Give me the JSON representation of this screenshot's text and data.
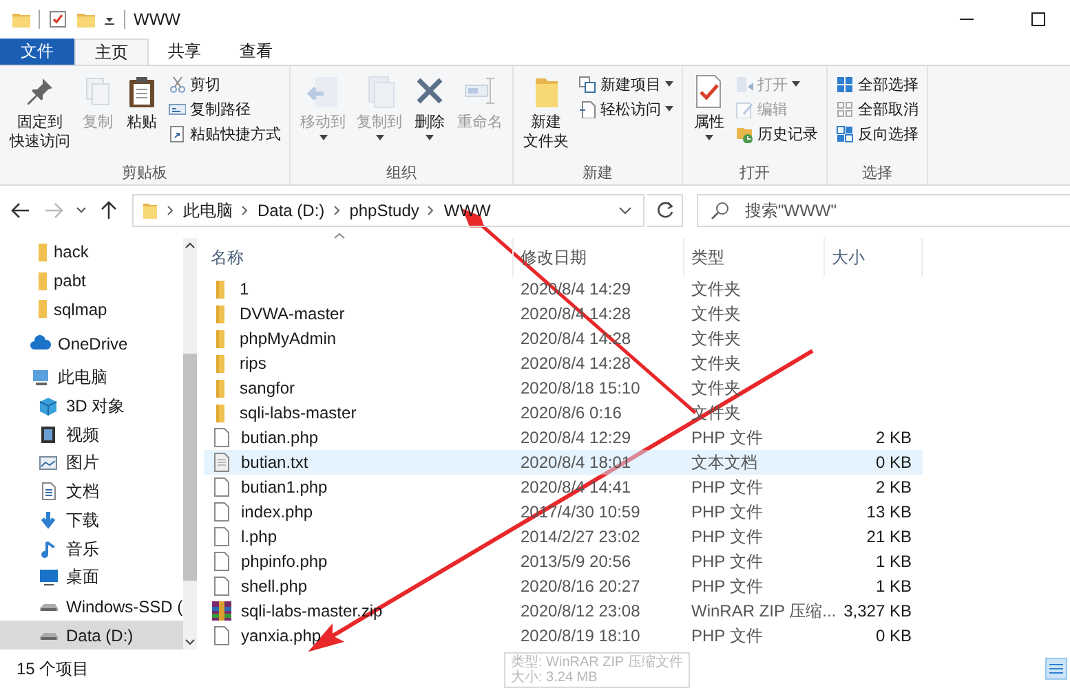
{
  "title_bar": {
    "title": "WWW"
  },
  "ribbon_tabs": [
    {
      "label": "文件",
      "kind": "file",
      "selected": false
    },
    {
      "label": "主页",
      "kind": "tab",
      "selected": true
    },
    {
      "label": "共享",
      "kind": "tab",
      "selected": false
    },
    {
      "label": "查看",
      "kind": "tab",
      "selected": false
    }
  ],
  "ribbon_groups": [
    {
      "label": "剪贴板",
      "commands": [
        {
          "label": [
            "固定到",
            "快速访问"
          ],
          "kind": "large",
          "disabled": false,
          "dropdown": false
        },
        {
          "label": "复制",
          "kind": "large",
          "disabled": true,
          "dropdown": false
        },
        {
          "label": "粘贴",
          "kind": "large",
          "disabled": false,
          "dropdown": false
        },
        {
          "label": "剪切",
          "kind": "small",
          "disabled": false,
          "dropdown": false
        },
        {
          "label": "复制路径",
          "kind": "small",
          "disabled": false,
          "dropdown": false
        },
        {
          "label": "粘贴快捷方式",
          "kind": "small",
          "disabled": false,
          "dropdown": false
        }
      ]
    },
    {
      "label": "组织",
      "commands": [
        {
          "label": "移动到",
          "kind": "large",
          "disabled": true,
          "dropdown": true
        },
        {
          "label": "复制到",
          "kind": "large",
          "disabled": true,
          "dropdown": true
        },
        {
          "label": "删除",
          "kind": "large",
          "disabled": false,
          "dropdown": true
        },
        {
          "label": "重命名",
          "kind": "large",
          "disabled": true,
          "dropdown": false
        }
      ]
    },
    {
      "label": "新建",
      "commands": [
        {
          "label": [
            "新建",
            "文件夹"
          ],
          "kind": "large",
          "disabled": false,
          "dropdown": false
        },
        {
          "label": "新建项目",
          "kind": "small",
          "disabled": false,
          "dropdown": true
        },
        {
          "label": "轻松访问",
          "kind": "small",
          "disabled": false,
          "dropdown": true
        }
      ]
    },
    {
      "label": "打开",
      "commands": [
        {
          "label": "属性",
          "kind": "large",
          "disabled": false,
          "dropdown": true
        },
        {
          "label": "打开",
          "kind": "small",
          "disabled": true,
          "dropdown": true
        },
        {
          "label": "编辑",
          "kind": "small",
          "disabled": true,
          "dropdown": false
        },
        {
          "label": "历史记录",
          "kind": "small",
          "disabled": false,
          "dropdown": false
        }
      ]
    },
    {
      "label": "选择",
      "commands": [
        {
          "label": "全部选择",
          "kind": "small",
          "disabled": false,
          "dropdown": false
        },
        {
          "label": "全部取消",
          "kind": "small",
          "disabled": false,
          "dropdown": false
        },
        {
          "label": "反向选择",
          "kind": "small",
          "disabled": false,
          "dropdown": false
        }
      ]
    }
  ],
  "address_bar": {
    "back_disabled": false,
    "forward_disabled": true,
    "breadcrumb": [
      "此电脑",
      "Data (D:)",
      "phpStudy",
      "WWW"
    ]
  },
  "search": {
    "placeholder": "搜索\"WWW\""
  },
  "sidebar": {
    "items": [
      {
        "label": "hack",
        "kind": "folder",
        "selected": false
      },
      {
        "label": "pabt",
        "kind": "folder",
        "selected": false
      },
      {
        "label": "sqlmap",
        "kind": "folder",
        "selected": false
      },
      {
        "label": "OneDrive",
        "kind": "cloud",
        "selected": false
      },
      {
        "label": "此电脑",
        "kind": "pc",
        "selected": false,
        "children": [
          {
            "label": "3D 对象",
            "kind": "cube",
            "selected": false
          },
          {
            "label": "视频",
            "kind": "video",
            "selected": false
          },
          {
            "label": "图片",
            "kind": "picture",
            "selected": false
          },
          {
            "label": "文档",
            "kind": "document",
            "selected": false
          },
          {
            "label": "下载",
            "kind": "download",
            "selected": false
          },
          {
            "label": "音乐",
            "kind": "music",
            "selected": false
          },
          {
            "label": "桌面",
            "kind": "desktop",
            "selected": false
          },
          {
            "label": "Windows-SSD (",
            "kind": "drive",
            "selected": false
          },
          {
            "label": "Data (D:)",
            "kind": "drive",
            "selected": true
          }
        ]
      }
    ]
  },
  "file_list": {
    "columns": [
      "名称",
      "修改日期",
      "类型",
      "大小"
    ],
    "rows": [
      {
        "name": "1",
        "modified": "2020/8/4 14:29",
        "type": "文件夹",
        "kind": "folder",
        "selected": false
      },
      {
        "name": "DVWA-master",
        "modified": "2020/8/4 14:28",
        "type": "文件夹",
        "kind": "folder",
        "selected": false
      },
      {
        "name": "phpMyAdmin",
        "modified": "2020/8/4 14:28",
        "type": "文件夹",
        "kind": "folder",
        "selected": false
      },
      {
        "name": "rips",
        "modified": "2020/8/4 14:28",
        "type": "文件夹",
        "kind": "folder",
        "selected": false
      },
      {
        "name": "sangfor",
        "modified": "2020/8/18 15:10",
        "type": "文件夹",
        "kind": "folder",
        "selected": false
      },
      {
        "name": "sqli-labs-master",
        "modified": "2020/8/6 0:16",
        "type": "文件夹",
        "kind": "folder",
        "selected": false
      },
      {
        "name": "butian.php",
        "modified": "2020/8/4 12:29",
        "type": "PHP 文件",
        "size": "2 KB",
        "kind": "file",
        "selected": false
      },
      {
        "name": "butian.txt",
        "modified": "2020/8/4 18:01",
        "type": "文本文档",
        "size": "0 KB",
        "kind": "text",
        "selected": true
      },
      {
        "name": "butian1.php",
        "modified": "2020/8/4 14:41",
        "type": "PHP 文件",
        "size": "2 KB",
        "kind": "file",
        "selected": false
      },
      {
        "name": "index.php",
        "modified": "2017/4/30 10:59",
        "type": "PHP 文件",
        "size": "13 KB",
        "kind": "file",
        "selected": false
      },
      {
        "name": "l.php",
        "modified": "2014/2/27 23:02",
        "type": "PHP 文件",
        "size": "21 KB",
        "kind": "file",
        "selected": false
      },
      {
        "name": "phpinfo.php",
        "modified": "2013/5/9 20:56",
        "type": "PHP 文件",
        "size": "1 KB",
        "kind": "file",
        "selected": false
      },
      {
        "name": "shell.php",
        "modified": "2020/8/16 20:27",
        "type": "PHP 文件",
        "size": "1 KB",
        "kind": "file",
        "selected": false
      },
      {
        "name": "sqli-labs-master.zip",
        "modified": "2020/8/12 23:08",
        "type": "WinRAR ZIP 压缩...",
        "size": "3,327 KB",
        "kind": "archive",
        "selected": false
      },
      {
        "name": "yanxia.php",
        "modified": "2020/8/19 18:10",
        "type": "PHP 文件",
        "size": "0 KB",
        "kind": "file",
        "selected": false
      }
    ]
  },
  "tooltip": {
    "lines": [
      "类型: WinRAR ZIP 压缩文件",
      "大小: 3.24 MB"
    ]
  },
  "status_bar": {
    "count": "15 个项目"
  }
}
